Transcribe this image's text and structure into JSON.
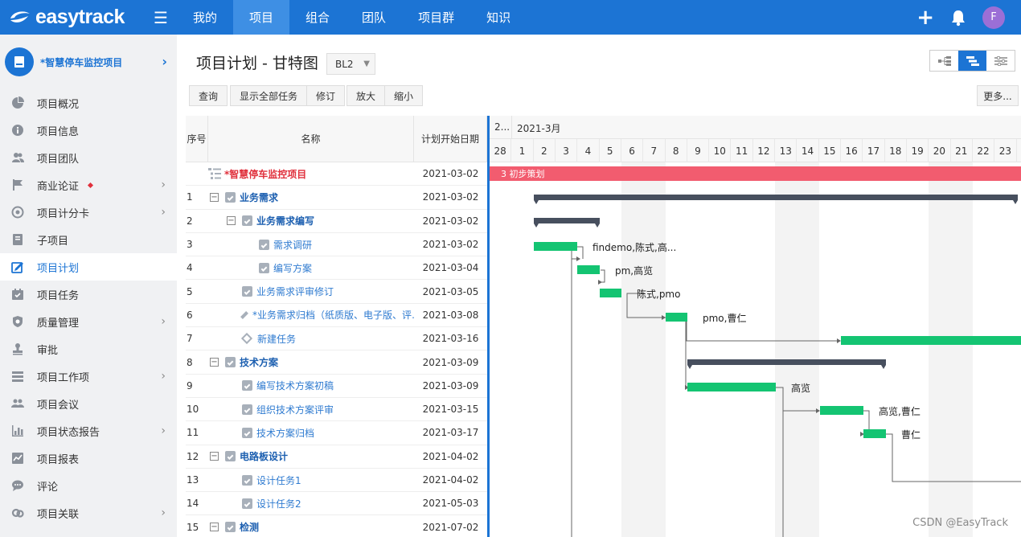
{
  "logo": "easytrack",
  "nav": {
    "tabs": [
      {
        "label": "我的"
      },
      {
        "label": "项目"
      },
      {
        "label": "组合"
      },
      {
        "label": "团队"
      },
      {
        "label": "项目群"
      },
      {
        "label": "知识"
      }
    ],
    "active_tab": "项目",
    "avatar_initial": "F"
  },
  "sidebar": {
    "project_name": "*智慧停车监控项目",
    "items": [
      {
        "label": "项目概况",
        "icon": "pie-chart-icon"
      },
      {
        "label": "项目信息",
        "icon": "info-icon"
      },
      {
        "label": "项目团队",
        "icon": "team-icon"
      },
      {
        "label": "商业论证",
        "icon": "flag-icon"
      },
      {
        "label": "项目计分卡",
        "icon": "target-icon"
      },
      {
        "label": "子项目",
        "icon": "subproject-icon"
      },
      {
        "label": "项目计划",
        "icon": "plan-icon"
      },
      {
        "label": "项目任务",
        "icon": "calendar-check-icon"
      },
      {
        "label": "质量管理",
        "icon": "shield-icon"
      },
      {
        "label": "审批",
        "icon": "stamp-icon"
      },
      {
        "label": "项目工作项",
        "icon": "list-icon"
      },
      {
        "label": "项目会议",
        "icon": "meeting-icon"
      },
      {
        "label": "项目状态报告",
        "icon": "bar-chart-icon"
      },
      {
        "label": "项目报表",
        "icon": "report-icon"
      },
      {
        "label": "评论",
        "icon": "comment-icon"
      },
      {
        "label": "项目关联",
        "icon": "link-icon"
      }
    ],
    "active_item": "项目计划"
  },
  "page": {
    "title": "项目计划 - 甘特图",
    "baseline": "BL2"
  },
  "toolbar": {
    "query": "查询",
    "show_all": "显示全部任务",
    "revise": "修订",
    "zoom_in": "放大",
    "zoom_out": "缩小",
    "more": "更多..."
  },
  "grid": {
    "headers": {
      "no": "序号",
      "name": "名称",
      "start": "计划开始日期"
    },
    "rows": [
      {
        "no": "",
        "name": "*智慧停车监控项目",
        "start": "2021-03-02"
      },
      {
        "no": "1",
        "name": "业务需求",
        "start": "2021-03-02"
      },
      {
        "no": "2",
        "name": "业务需求编写",
        "start": "2021-03-02"
      },
      {
        "no": "3",
        "name": "需求调研",
        "start": "2021-03-02"
      },
      {
        "no": "4",
        "name": "编写方案",
        "start": "2021-03-04"
      },
      {
        "no": "5",
        "name": "业务需求评审修订",
        "start": "2021-03-05"
      },
      {
        "no": "6",
        "name": "*业务需求归档（纸质版、电子版、评…",
        "start": "2021-03-08"
      },
      {
        "no": "7",
        "name": "新建任务",
        "start": "2021-03-16"
      },
      {
        "no": "8",
        "name": "技术方案",
        "start": "2021-03-09"
      },
      {
        "no": "9",
        "name": "编写技术方案初稿",
        "start": "2021-03-09"
      },
      {
        "no": "10",
        "name": "组织技术方案评审",
        "start": "2021-03-15"
      },
      {
        "no": "11",
        "name": "技术方案归档",
        "start": "2021-03-17"
      },
      {
        "no": "12",
        "name": "电路板设计",
        "start": "2021-04-02"
      },
      {
        "no": "13",
        "name": "设计任务1",
        "start": "2021-04-02"
      },
      {
        "no": "14",
        "name": "设计任务2",
        "start": "2021-05-03"
      },
      {
        "no": "15",
        "name": "检测",
        "start": "2021-07-02"
      }
    ]
  },
  "gantt": {
    "prev_month": "2...",
    "month": "2021-3月",
    "days": [
      "28",
      "1",
      "2",
      "3",
      "4",
      "5",
      "6",
      "7",
      "8",
      "9",
      "10",
      "11",
      "12",
      "13",
      "14",
      "15",
      "16",
      "17",
      "18",
      "19",
      "20",
      "21",
      "22",
      "23"
    ],
    "phase": "3 初步策划",
    "resources": {
      "r3": "findemo,陈式,高...",
      "r4": "pm,高览",
      "r5": "陈式,pmo",
      "r6": "pmo,曹仁",
      "r9": "高览",
      "r10": "高览,曹仁",
      "r11": "曹仁"
    },
    "colors": {
      "task": "#14c472",
      "summary": "#474f5e",
      "phase": "#f25c6f"
    }
  },
  "watermark": "CSDN @EasyTrack"
}
